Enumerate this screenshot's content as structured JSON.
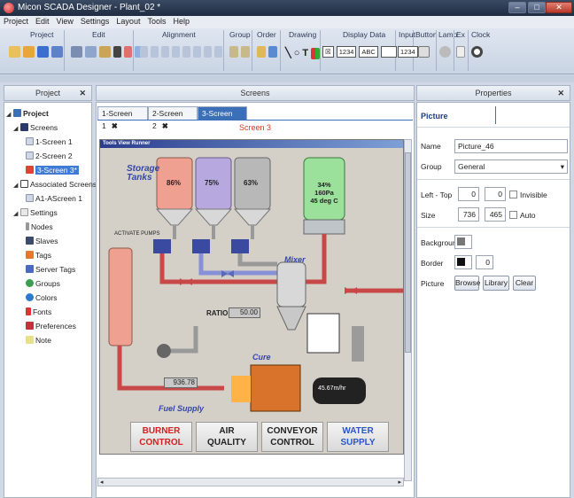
{
  "window": {
    "title": "Micon SCADA Designer - Plant_02 *",
    "minimize": "–",
    "maximize": "□",
    "close": "✕"
  },
  "menu": [
    "Project",
    "Edit",
    "View",
    "Settings",
    "Layout",
    "Tools",
    "Help"
  ],
  "ribbon": {
    "groups": [
      "Project",
      "Edit",
      "Alignment",
      "Group",
      "Order",
      "Drawing",
      "Display Data",
      "Input",
      "Button",
      "Lamp",
      "Ex",
      "Clock"
    ],
    "display_data_samples": [
      "1234",
      "ABC"
    ],
    "input_sample": "1234"
  },
  "project_panel": {
    "title": "Project",
    "close": "✕",
    "tree": [
      {
        "label": "Project",
        "level": 0
      },
      {
        "label": "Screens",
        "level": 1
      },
      {
        "label": "1-Screen 1",
        "level": 2
      },
      {
        "label": "2-Screen 2",
        "level": 2
      },
      {
        "label": "3-Screen 3*",
        "level": 2
      },
      {
        "label": "Associated Screens",
        "level": 1
      },
      {
        "label": "A1-AScreen 1",
        "level": 2
      },
      {
        "label": "Settings",
        "level": 1
      },
      {
        "label": "Nodes",
        "level": 2
      },
      {
        "label": "Slaves",
        "level": 2
      },
      {
        "label": "Tags",
        "level": 2
      },
      {
        "label": "Server Tags",
        "level": 2
      },
      {
        "label": "Groups",
        "level": 2
      },
      {
        "label": "Colors",
        "level": 2
      },
      {
        "label": "Fonts",
        "level": 2
      },
      {
        "label": "Preferences",
        "level": 2
      },
      {
        "label": "Note",
        "level": 2
      }
    ]
  },
  "screens_panel": {
    "title": "Screens",
    "tabs": [
      {
        "label": "1-Screen 1",
        "close": "✖"
      },
      {
        "label": "2-Screen 2",
        "close": "✖"
      },
      {
        "label": "3-Screen 3",
        "close": "✖"
      }
    ],
    "current_screen_label": "Screen 3"
  },
  "scada": {
    "window_title": "Tools View Runner",
    "storage_title_1": "Storage",
    "storage_title_2": "Tanks",
    "tank1_pct": "86%",
    "tank2_pct": "75%",
    "tank3_pct": "63%",
    "reactor_lines": [
      "34%",
      "160Pa",
      "45 deg C"
    ],
    "activate_pumps": "ACTIVATE PUMPS",
    "mixer": "Mixer",
    "ratio_label": "RATIO",
    "ratio_value": "50.00",
    "cure": "Cure",
    "fuel_value": "936.78",
    "fuel_supply": "Fuel Supply",
    "conveyor_speed": "45.67m/hr",
    "buttons": [
      {
        "line1": "BURNER",
        "line2": "CONTROL",
        "color": "#d42020"
      },
      {
        "line1": "AIR",
        "line2": "QUALITY",
        "color": "#222222"
      },
      {
        "line1": "CONVEYOR",
        "line2": "CONTROL",
        "color": "#222222"
      },
      {
        "line1": "WATER",
        "line2": "SUPPLY",
        "color": "#2a55c8"
      }
    ]
  },
  "properties": {
    "title": "Properties",
    "close": "✕",
    "tab_label": "Picture",
    "name_label": "Name",
    "name_value": "Picture_46",
    "group_label": "Group",
    "group_value": "General",
    "left_top_label": "Left - Top",
    "left_value": "0",
    "top_value": "0",
    "invisible_label": "Invisible",
    "size_label": "Size",
    "width_value": "736",
    "height_value": "465",
    "auto_label": "Auto",
    "background_label": "Background",
    "border_label": "Border",
    "border_width_value": "0",
    "picture_label": "Picture",
    "browse": "Browse",
    "library": "Library",
    "clear": "Clear"
  },
  "colors": {
    "accent": "#3b6fb8",
    "tank1": "#f0a090",
    "tank2": "#b8a8e0",
    "tank3": "#b8b8b8",
    "reactor": "#9be09b",
    "pipe_red": "#c84848",
    "pipe_blue": "#8890d8"
  }
}
